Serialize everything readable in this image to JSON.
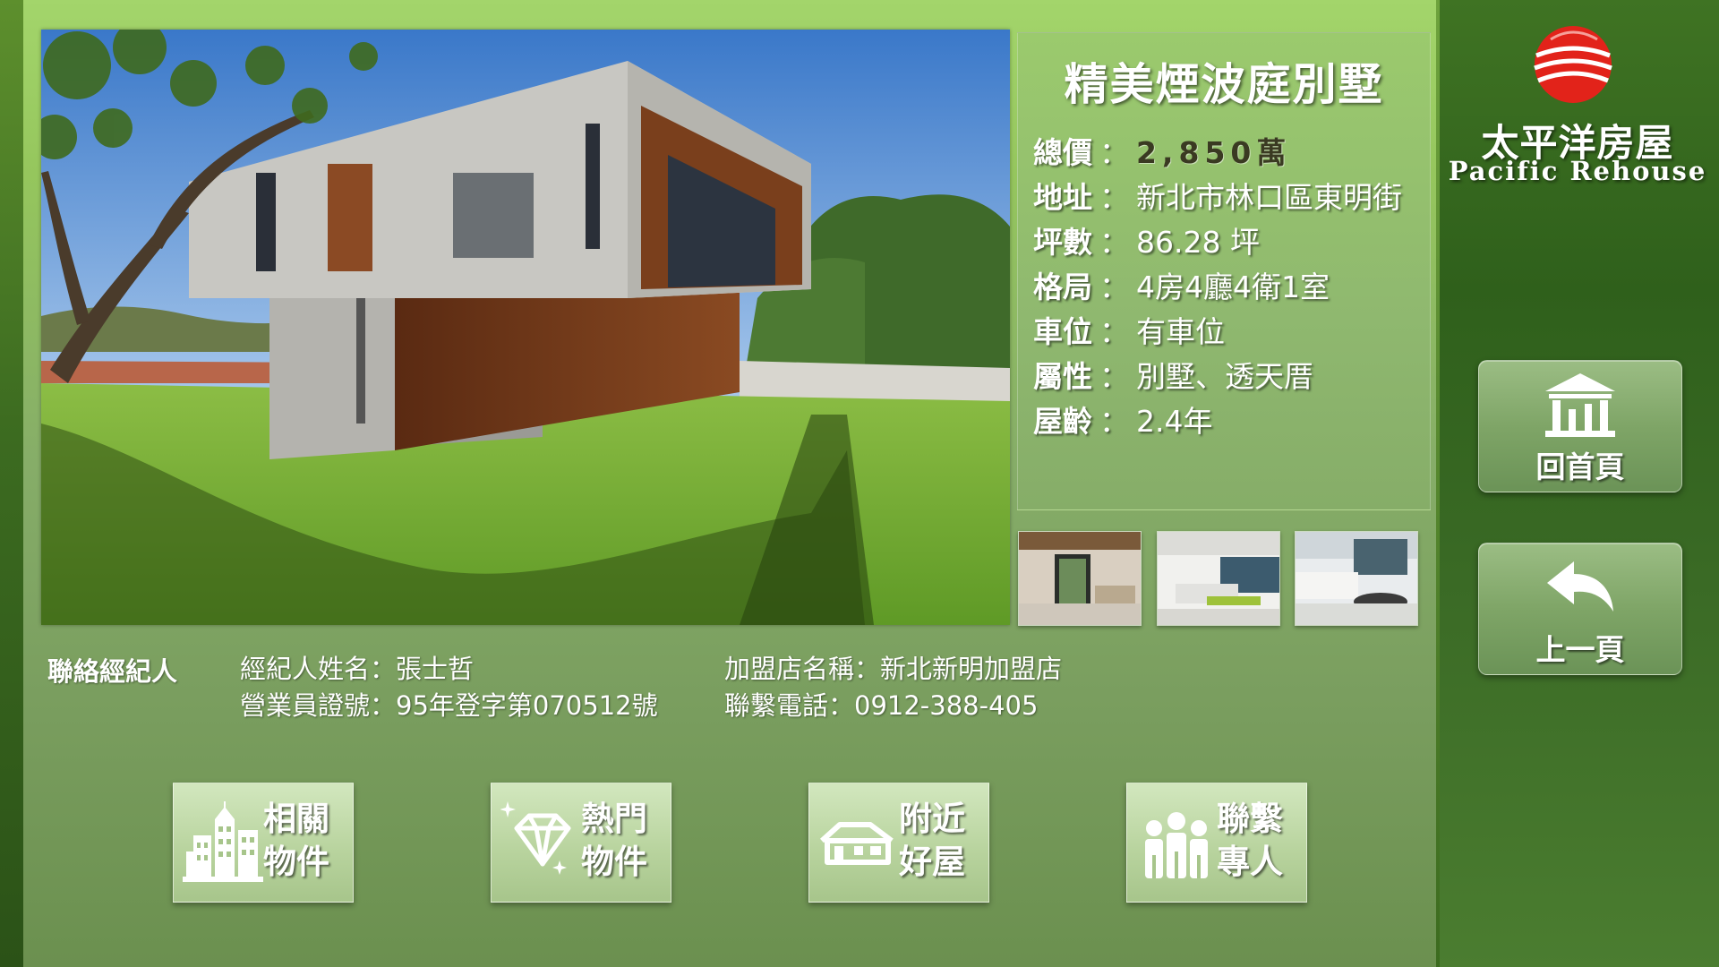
{
  "listing": {
    "title": "精美煙波庭別墅",
    "specs": [
      {
        "label": "總價",
        "value": "2,850萬"
      },
      {
        "label": "地址",
        "value": "新北市林口區東明街"
      },
      {
        "label": "坪數",
        "value": "86.28 坪"
      },
      {
        "label": "格局",
        "value": "4房4廳4衛1室"
      },
      {
        "label": "車位",
        "value": "有車位"
      },
      {
        "label": "屬性",
        "value": "別墅、透天厝"
      },
      {
        "label": "屋齡",
        "value": "2.4年"
      }
    ],
    "separator": "："
  },
  "agent": {
    "heading": "聯絡經紀人",
    "name_line": "經紀人姓名：張士哲",
    "license_line": "營業員證號：95年登字第070512號",
    "store_line": "加盟店名稱：新北新明加盟店",
    "phone_line": "聯繫電話：0912-388-405"
  },
  "actions": [
    {
      "line1": "相關",
      "line2": "物件",
      "icon": "building-icon"
    },
    {
      "line1": "熱門",
      "line2": "物件",
      "icon": "diamond-icon"
    },
    {
      "line1": "附近",
      "line2": "好屋",
      "icon": "house-icon"
    },
    {
      "line1": "聯繫",
      "line2": "專人",
      "icon": "people-icon"
    }
  ],
  "brand": {
    "name_cn": "太平洋房屋",
    "name_en": "Pacific Rehouse"
  },
  "nav": {
    "home_label": "回首頁",
    "back_label": "上一頁"
  },
  "colors": {
    "panel_green": "#95c65d",
    "dark_strip": "#2f601b",
    "logo_red": "#e2231a",
    "price_text": "#3a3a22"
  }
}
